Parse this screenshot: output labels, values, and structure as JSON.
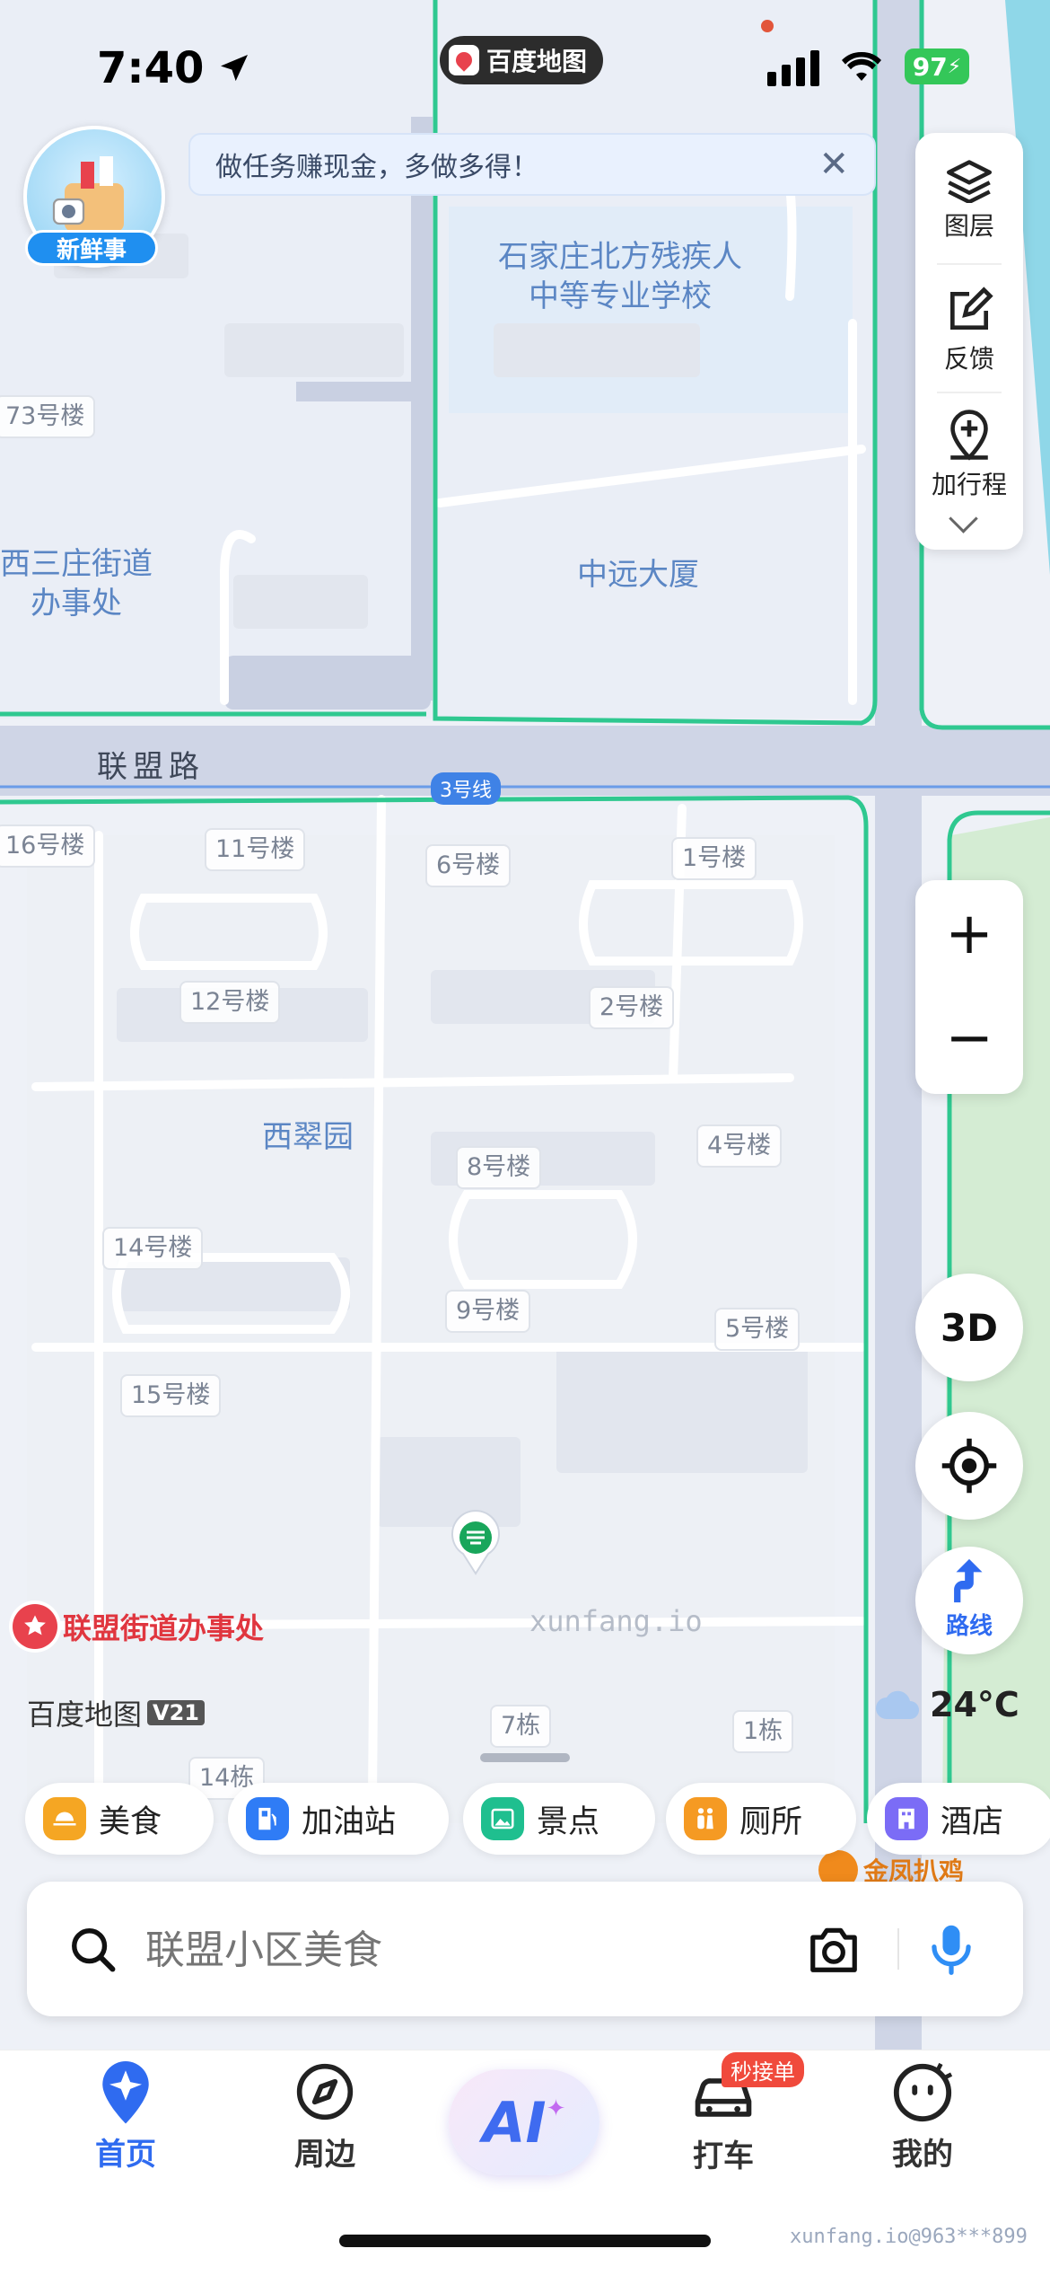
{
  "status_bar": {
    "time": "7:40",
    "app_badge": "百度地图",
    "battery": "97"
  },
  "promo": {
    "badge": "新鲜事",
    "banner_text": "做任务赚现金，多做多得！"
  },
  "side_tools": [
    {
      "label": "图层",
      "icon": "layers-icon"
    },
    {
      "label": "反馈",
      "icon": "feedback-icon"
    },
    {
      "label": "加行程",
      "icon": "add-trip-icon"
    }
  ],
  "zoom": {
    "in": "+",
    "out": "−"
  },
  "controls": {
    "view_3d": "3D",
    "route": "路线"
  },
  "weather": {
    "temp": "24°C"
  },
  "map": {
    "road": "联盟路",
    "metro_line": "3号线",
    "school": "石家庄北方残疾人\n中等专业学校",
    "office_left": "西三庄街道\n办事处",
    "building_tower": "中远大厦",
    "residential": "西翠园",
    "office_poi": "联盟街道办事处",
    "shop_poi": "金凤扒鸡",
    "logo": "百度地图",
    "logo_version": "V21",
    "watermark": "xunfang.io",
    "buildings": [
      "73号楼",
      "16号楼",
      "11号楼",
      "6号楼",
      "1号楼",
      "12号楼",
      "2号楼",
      "4号楼",
      "8号楼",
      "14号楼",
      "9号楼",
      "5号楼",
      "15号楼",
      "7栋",
      "1栋",
      "14栋"
    ]
  },
  "categories": [
    {
      "label": "美食",
      "color": "#f5a623"
    },
    {
      "label": "加油站",
      "color": "#2f7cf6"
    },
    {
      "label": "景点",
      "color": "#1fbf8f"
    },
    {
      "label": "厕所",
      "color": "#f59a23"
    },
    {
      "label": "酒店",
      "color": "#7b6cf6"
    }
  ],
  "search": {
    "placeholder": "联盟小区美食"
  },
  "tabbar": [
    {
      "label": "首页",
      "active": true
    },
    {
      "label": "周边",
      "active": false
    },
    {
      "label": "AI",
      "active": false
    },
    {
      "label": "打车",
      "badge": "秒接单",
      "active": false
    },
    {
      "label": "我的",
      "active": false
    }
  ],
  "footer_watermark": "xunfang.io@963***899",
  "colors": {
    "accent": "#2f6bf0",
    "boundary": "#2fc890",
    "road": "#cfd5e6",
    "green": "#d6ecd5"
  }
}
